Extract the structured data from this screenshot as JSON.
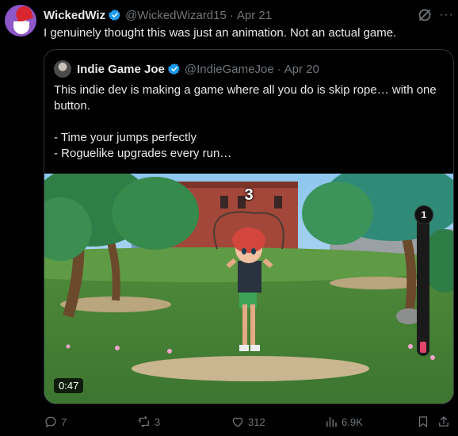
{
  "post": {
    "author_name": "WickedWiz",
    "author_handle": "@WickedWizard15",
    "separator": "·",
    "date": "Apr 21",
    "more_label": "···",
    "text": "I genuinely thought this was just an animation. Not an actual game."
  },
  "quote": {
    "author_name": "Indie Game Joe",
    "author_handle": "@IndieGameJoe",
    "separator": "·",
    "date": "Apr 20",
    "lines": [
      "This indie dev is making a game where all you do is skip rope… with one button.",
      "",
      "- Time your jumps perfectly",
      "- Roguelike upgrades every run…"
    ]
  },
  "video": {
    "countdown": "3",
    "meter_count": "1",
    "meter_level": 0.08,
    "duration": "0:47"
  },
  "actions": {
    "replies": "7",
    "reposts": "3",
    "likes": "312",
    "views": "6.9K"
  },
  "colors": {
    "background": "#000000",
    "text": "#e7e9ea",
    "muted": "#71767b",
    "verified": "#1d9bf0",
    "border": "#2f3336",
    "meter_fill": "#e04469"
  },
  "icons": [
    "verified-badge-icon",
    "grok-icon",
    "more-icon",
    "reply-icon",
    "repost-icon",
    "like-icon",
    "views-icon",
    "bookmark-icon",
    "share-icon"
  ]
}
